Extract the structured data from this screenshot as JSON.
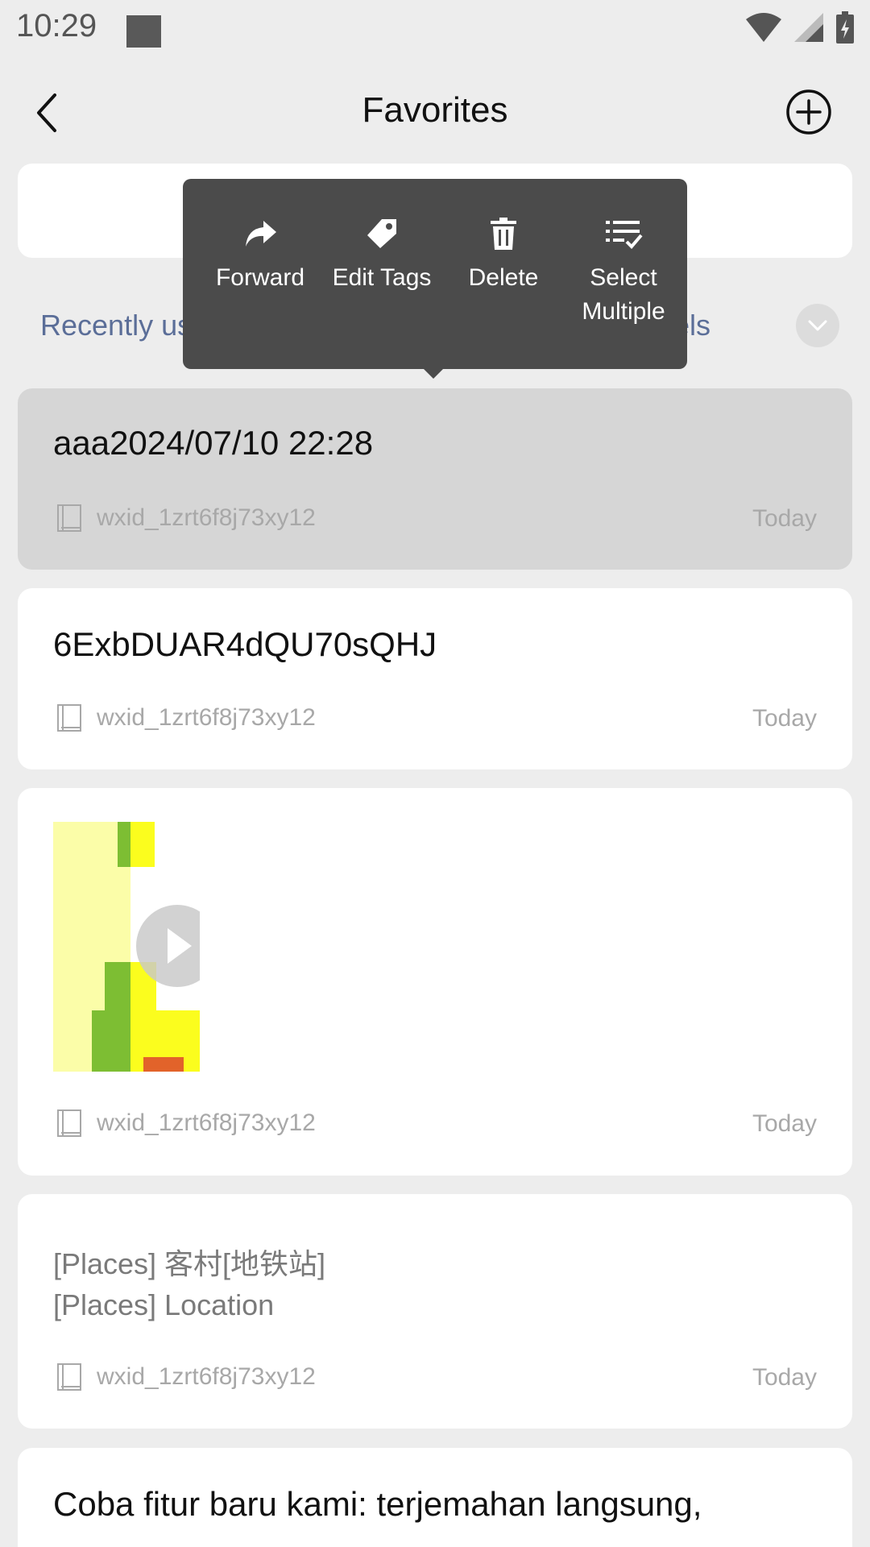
{
  "status": {
    "time": "10:29"
  },
  "header": {
    "title": "Favorites"
  },
  "filter": {
    "left_text": "Recently us",
    "right_text": "els"
  },
  "popup": {
    "forward": "Forward",
    "edit_tags": "Edit Tags",
    "delete": "Delete",
    "select_line1": "Select",
    "select_line2": "Multiple"
  },
  "cards": [
    {
      "text": "aaa2024/07/10 22:28",
      "source": "wxid_1zrt6f8j73xy12",
      "date": "Today"
    },
    {
      "text": "6ExbDUAR4dQU70sQHJ",
      "source": "wxid_1zrt6f8j73xy12",
      "date": "Today"
    },
    {
      "source": "wxid_1zrt6f8j73xy12",
      "date": "Today"
    },
    {
      "line1": "[Places] 客村[地铁站]",
      "line2": "[Places] Location",
      "source": "wxid_1zrt6f8j73xy12",
      "date": "Today"
    },
    {
      "line1": "Coba fitur baru kami: terjemahan langsung,"
    }
  ]
}
